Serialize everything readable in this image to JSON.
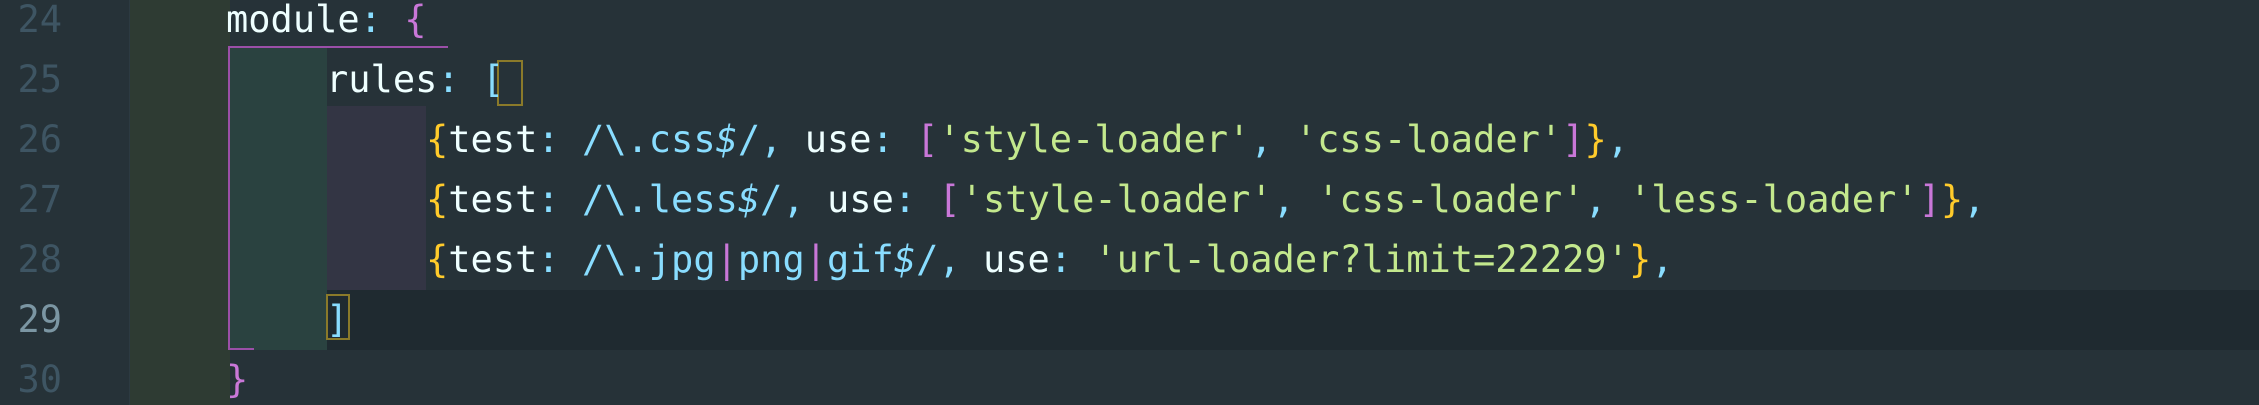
{
  "theme": {
    "background": "#263238",
    "current_line": "#1f2a30",
    "keyword_text": "#eeffff",
    "punctuation": "#89ddff",
    "string": "#c3e88d",
    "bracket_yellow": "#ffcb2b",
    "bracket_magenta": "#c977d8"
  },
  "editor": {
    "current_line_number": "29",
    "lines": [
      {
        "number": "24"
      },
      {
        "number": "25"
      },
      {
        "number": "26"
      },
      {
        "number": "27"
      },
      {
        "number": "28"
      },
      {
        "number": "29"
      },
      {
        "number": "30"
      }
    ],
    "code": {
      "l24": {
        "key": "module",
        "colon": ": ",
        "open": "{"
      },
      "l25": {
        "key": "rules",
        "colon": ": ",
        "open": "["
      },
      "l26": {
        "open": "{",
        "test_key": "test",
        "colon1": ": ",
        "regex_a": "/\\.css",
        "regex_b": "$",
        "regex_c": "/",
        "comma1": ", ",
        "use_key": "use",
        "colon2": ": ",
        "arr_open": "[",
        "s1": "'style-loader'",
        "comma2": ", ",
        "s2": "'css-loader'",
        "arr_close": "]",
        "close": "}",
        "comma3": ","
      },
      "l27": {
        "open": "{",
        "test_key": "test",
        "colon1": ": ",
        "regex_a": "/\\.less",
        "regex_b": "$",
        "regex_c": "/",
        "comma1": ", ",
        "use_key": "use",
        "colon2": ": ",
        "arr_open": "[",
        "s1": "'style-loader'",
        "comma2": ", ",
        "s2": "'css-loader'",
        "comma3": ", ",
        "s3": "'less-loader'",
        "arr_close": "]",
        "close": "}",
        "comma4": ","
      },
      "l28": {
        "open": "{",
        "test_key": "test",
        "colon1": ": ",
        "regex_a": "/\\.jpg",
        "pipe1": "|",
        "regex_b": "png",
        "pipe2": "|",
        "regex_c": "gif",
        "regex_d": "$",
        "regex_e": "/",
        "comma1": ", ",
        "use_key": "use",
        "colon2": ": ",
        "s1": "'url-loader?limit=22229'",
        "close": "}",
        "comma2": ","
      },
      "l29": {
        "close": "]"
      },
      "l30": {
        "close": "}"
      }
    }
  }
}
